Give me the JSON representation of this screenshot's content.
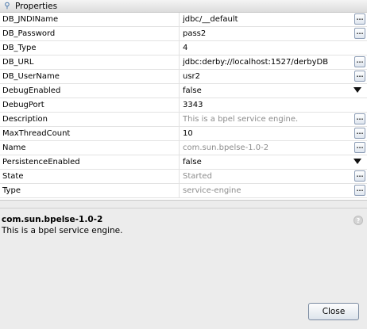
{
  "panel": {
    "title": "Properties",
    "icon": "property-pin-icon"
  },
  "properties": [
    {
      "name": "DB_JNDIName",
      "value": "jdbc/__default",
      "readonly": false,
      "editor": "ellipsis"
    },
    {
      "name": "DB_Password",
      "value": "pass2",
      "readonly": false,
      "editor": "ellipsis"
    },
    {
      "name": "DB_Type",
      "value": "4",
      "readonly": false,
      "editor": "none"
    },
    {
      "name": "DB_URL",
      "value": "jdbc:derby://localhost:1527/derbyDB",
      "readonly": false,
      "editor": "ellipsis"
    },
    {
      "name": "DB_UserName",
      "value": "usr2",
      "readonly": false,
      "editor": "ellipsis"
    },
    {
      "name": "DebugEnabled",
      "value": "false",
      "readonly": false,
      "editor": "dropdown"
    },
    {
      "name": "DebugPort",
      "value": "3343",
      "readonly": false,
      "editor": "none"
    },
    {
      "name": "Description",
      "value": "This is a bpel service engine.",
      "readonly": true,
      "editor": "ellipsis"
    },
    {
      "name": "MaxThreadCount",
      "value": "10",
      "readonly": false,
      "editor": "ellipsis"
    },
    {
      "name": "Name",
      "value": "com.sun.bpelse-1.0-2",
      "readonly": true,
      "editor": "ellipsis"
    },
    {
      "name": "PersistenceEnabled",
      "value": "false",
      "readonly": false,
      "editor": "dropdown"
    },
    {
      "name": "State",
      "value": "Started",
      "readonly": true,
      "editor": "ellipsis"
    },
    {
      "name": "Type",
      "value": "service-engine",
      "readonly": true,
      "editor": "ellipsis"
    }
  ],
  "description": {
    "title": "com.sun.bpelse-1.0-2",
    "text": "This is a bpel service engine.",
    "help_icon": "?"
  },
  "buttons": {
    "close_label": "Close",
    "ellipsis_label": "..."
  }
}
